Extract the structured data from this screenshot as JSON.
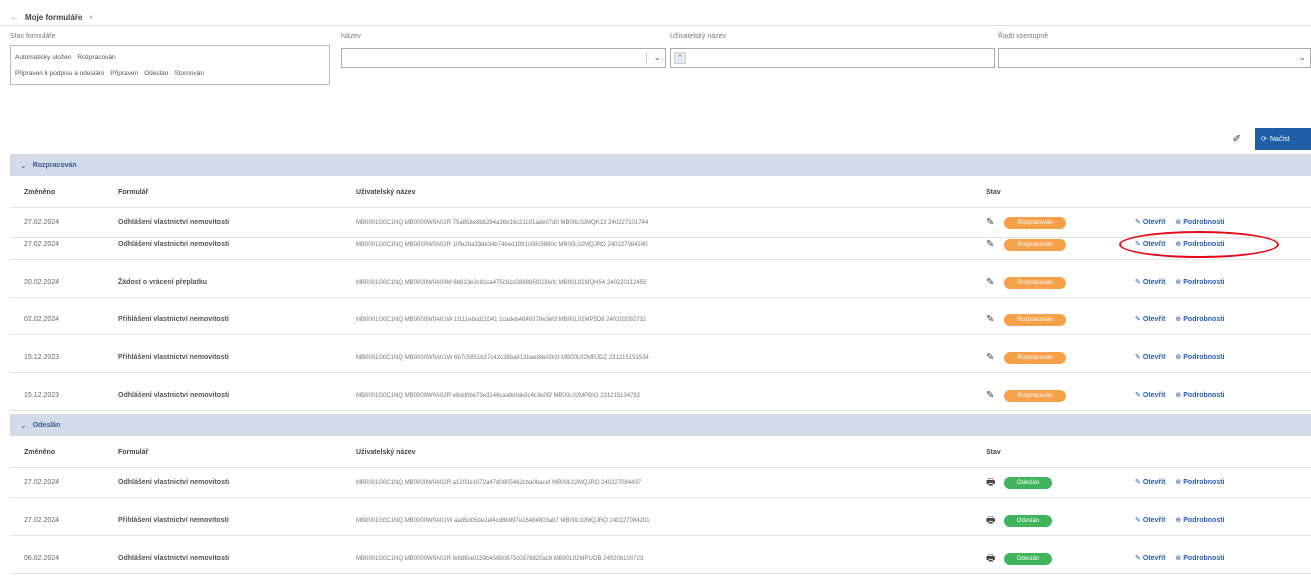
{
  "tab": {
    "back_icon": "←",
    "title": "Moje formuláře",
    "close_icon": "×"
  },
  "filters": {
    "status_label": "Stav formuláře",
    "status_options_row1": [
      "Automaticky uložen",
      "Rozpracován"
    ],
    "status_options_row2": [
      "Připraven k podpisu a odeslání",
      "Připraven",
      "Odeslán",
      "Stornován"
    ],
    "name_label": "Název",
    "username_label": "Uživatelský název",
    "sort_label": "Řadit vzestupně",
    "username_tag": "*"
  },
  "actions": {
    "clear_icon": "✐",
    "search_icon": "⟳",
    "search_label": "Načíst"
  },
  "columns": {
    "date": "Změněno",
    "form": "Formulář",
    "user": "Uživatelský název",
    "state": "Stav"
  },
  "groups": [
    {
      "name": "Rozpracován",
      "rows": [
        {
          "date": "27.02.2024",
          "form": "Odhlášení vlastnictví nemovitosti",
          "user": "MB0001G0C1NQ MB0000W0A02R 75a858e8bb294a36b16c21c01ade07d0 MB00L02MQK13 240227101744",
          "state": "Rozpracován"
        },
        {
          "date": "27.02.2024",
          "form": "Odhlášení vlastnictví nemovitosti",
          "user": "MB0001G0C1NQ MB0000W0A02R 10fe2ba33de34b74bed1991c08c5880c MB00L02MQJRO 240227084240",
          "state": "Rozpracován"
        },
        {
          "date": "20.02.2024",
          "form": "Žádost o vrácení přeplatku",
          "user": "MB0001G0C1NQ MB0000W0A09M 6b813e3c81ca475c81d3888959100efc MB00L02MQH54 240220112455",
          "state": "Rozpracován"
        },
        {
          "date": "02.02.2024",
          "form": "Přihlášení vlastnictví nemovitosti",
          "user": "MB0001G0C1NQ MB0000W0A01W 1f111ebcd11041 1cadeb4840378e3ef3 MB00L02MP5D8 240202092732",
          "state": "Rozpracován"
        },
        {
          "date": "15.12.2023",
          "form": "Přihlášení vlastnictví nemovitosti",
          "user": "MB0001G0C1NQ MB0000W0A01W 6b7c5851b17c42c38ba613baeb8e00c0 MB00L02MRJDZ 231215151534",
          "state": "Rozpracován"
        },
        {
          "date": "15.12.2023",
          "form": "Odhlášení vlastnictví nemovitosti",
          "user": "MB0001G0C1NQ MB0000W0A02R e6dd0be73e3146caafe0de3c4c3e05f MB00L02MPBIO 231215134782",
          "state": "Rozpracován"
        }
      ]
    },
    {
      "name": "Odeslán",
      "rows": [
        {
          "date": "27.02.2024",
          "form": "Odhlášení vlastnictví nemovitosti",
          "user": "MB0001G0C1NQ MB0000W0A02R a1203e1072a47d0805482cba0bacef MB00L02MQJRO 240227084437",
          "state": "Odeslán"
        },
        {
          "date": "27.02.2024",
          "form": "Přihlášení vlastnictví nemovitosti",
          "user": "MB0001G0C1NQ MB0000W0A01W aa85d05de2af4cd8b997e16484803ab7 MB00L02MQJRO 240227084201",
          "state": "Odeslán"
        },
        {
          "date": "06.02.2024",
          "form": "Odhlášení vlastnictví nemovitosti",
          "user": "MB0001G0C1NQ MB0000W0A02R fefd80a0159b456b0875c0876820ac9 MB00L02MPUOB 240206100723",
          "state": "Odeslán"
        }
      ]
    }
  ],
  "row_actions": {
    "open_icon": "✎",
    "open_label": "Otevřít",
    "details_icon": "⊕",
    "details_label": "Podrobnosti"
  },
  "icons": {
    "draft": "✎",
    "sent": "🖶"
  },
  "colors": {
    "accent": "#1f5fa8",
    "draft_badge": "#f7a04a",
    "sent_badge": "#41b35b",
    "group_bg": "#d4dbe8",
    "annotation": "#e30b17"
  }
}
